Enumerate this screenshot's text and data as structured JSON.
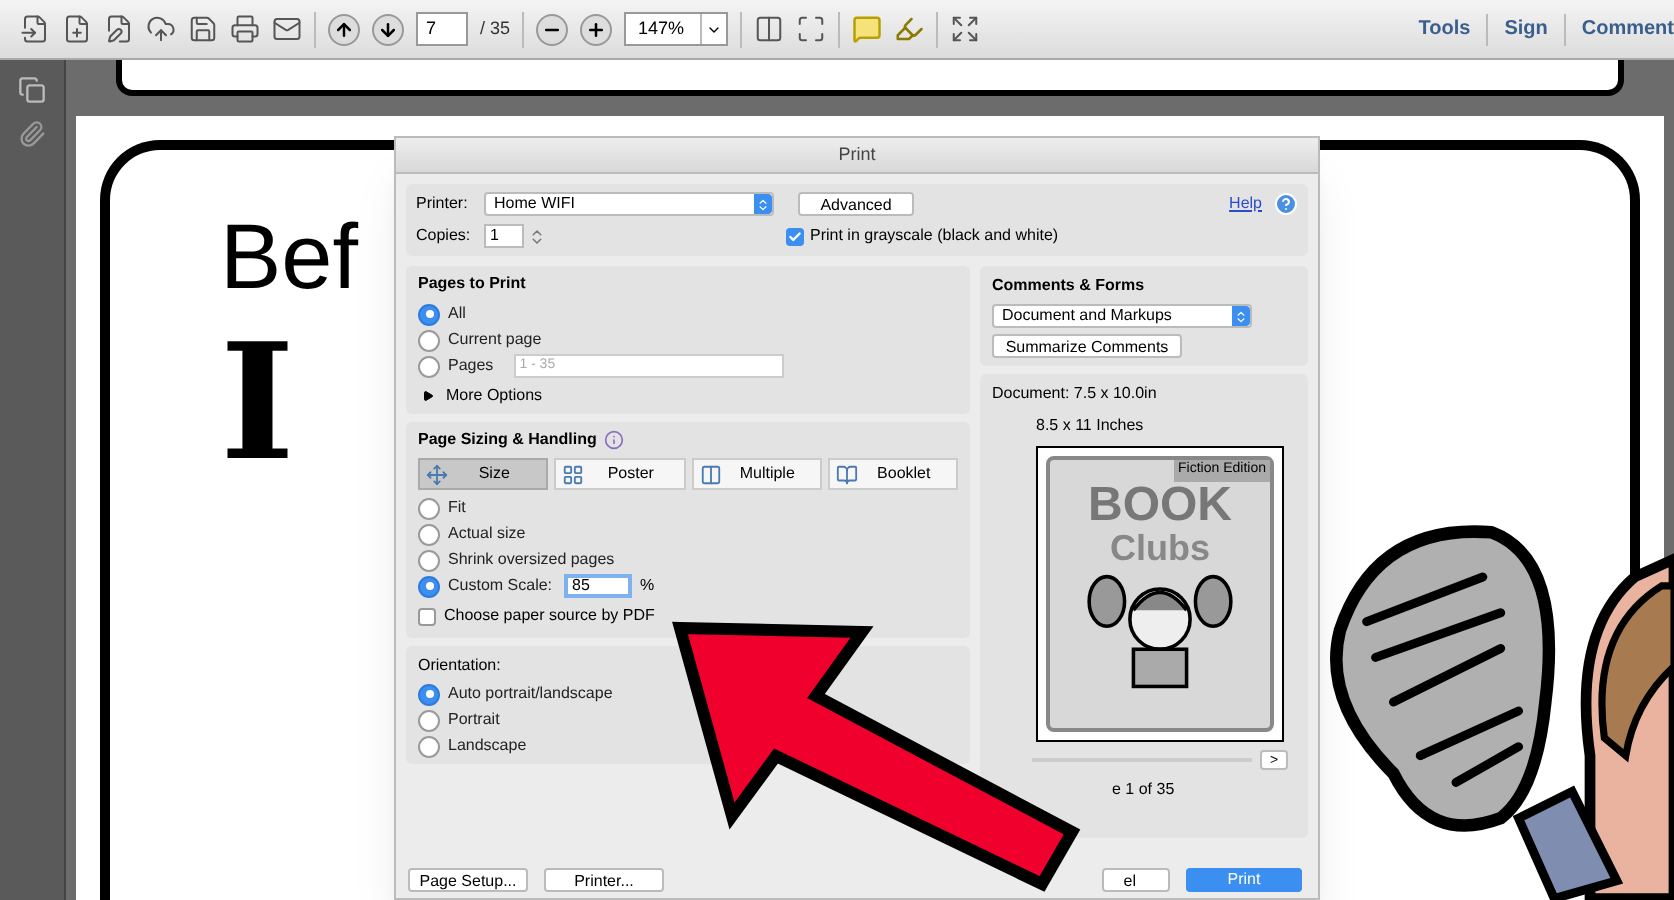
{
  "toolbar": {
    "page_number": "7",
    "page_total": "/ 35",
    "zoom": "147%",
    "links": [
      "Tools",
      "Sign",
      "Comment"
    ]
  },
  "document": {
    "heading": "Bef",
    "big_letter": "I"
  },
  "print_dialog": {
    "title": "Print",
    "printer_label": "Printer:",
    "printer": "Home WIFI",
    "advanced": "Advanced",
    "help": "Help",
    "copies_label": "Copies:",
    "copies": "1",
    "grayscale": {
      "label": "Print in grayscale (black and white)",
      "checked": true
    },
    "pages_to_print": {
      "title": "Pages to Print",
      "options": [
        {
          "label": "All",
          "selected": true
        },
        {
          "label": "Current page",
          "selected": false
        },
        {
          "label": "Pages",
          "selected": false
        }
      ],
      "pages_placeholder": "1 - 35",
      "more_options": "More Options"
    },
    "sizing": {
      "title": "Page Sizing & Handling",
      "tabs": [
        {
          "label": "Size",
          "selected": true
        },
        {
          "label": "Poster",
          "selected": false
        },
        {
          "label": "Multiple",
          "selected": false
        },
        {
          "label": "Booklet",
          "selected": false
        }
      ],
      "options": [
        {
          "label": "Fit",
          "selected": false
        },
        {
          "label": "Actual size",
          "selected": false
        },
        {
          "label": "Shrink oversized pages",
          "selected": false
        },
        {
          "label": "Custom Scale:",
          "selected": true
        }
      ],
      "scale": "85",
      "percent": "%",
      "paper_source": {
        "label": "Choose paper source by PDF",
        "checked": false
      }
    },
    "orientation": {
      "title": "Orientation:",
      "options": [
        {
          "label": "Auto portrait/landscape",
          "selected": true
        },
        {
          "label": "Portrait",
          "selected": false
        },
        {
          "label": "Landscape",
          "selected": false
        }
      ]
    },
    "comments_forms": {
      "title": "Comments & Forms",
      "value": "Document and Markups",
      "summarize": "Summarize Comments"
    },
    "preview": {
      "document_size": "Document: 7.5 x 10.0in",
      "paper_size": "8.5 x 11 Inches",
      "page_label": "Fiction Edition",
      "page_title": "BOOK",
      "page_subtitle": "Clubs",
      "next": ">",
      "page_counter": "e 1 of 35"
    },
    "buttons": {
      "page_setup": "Page Setup...",
      "printer": "Printer...",
      "cancel": "el",
      "print": "Print"
    }
  }
}
